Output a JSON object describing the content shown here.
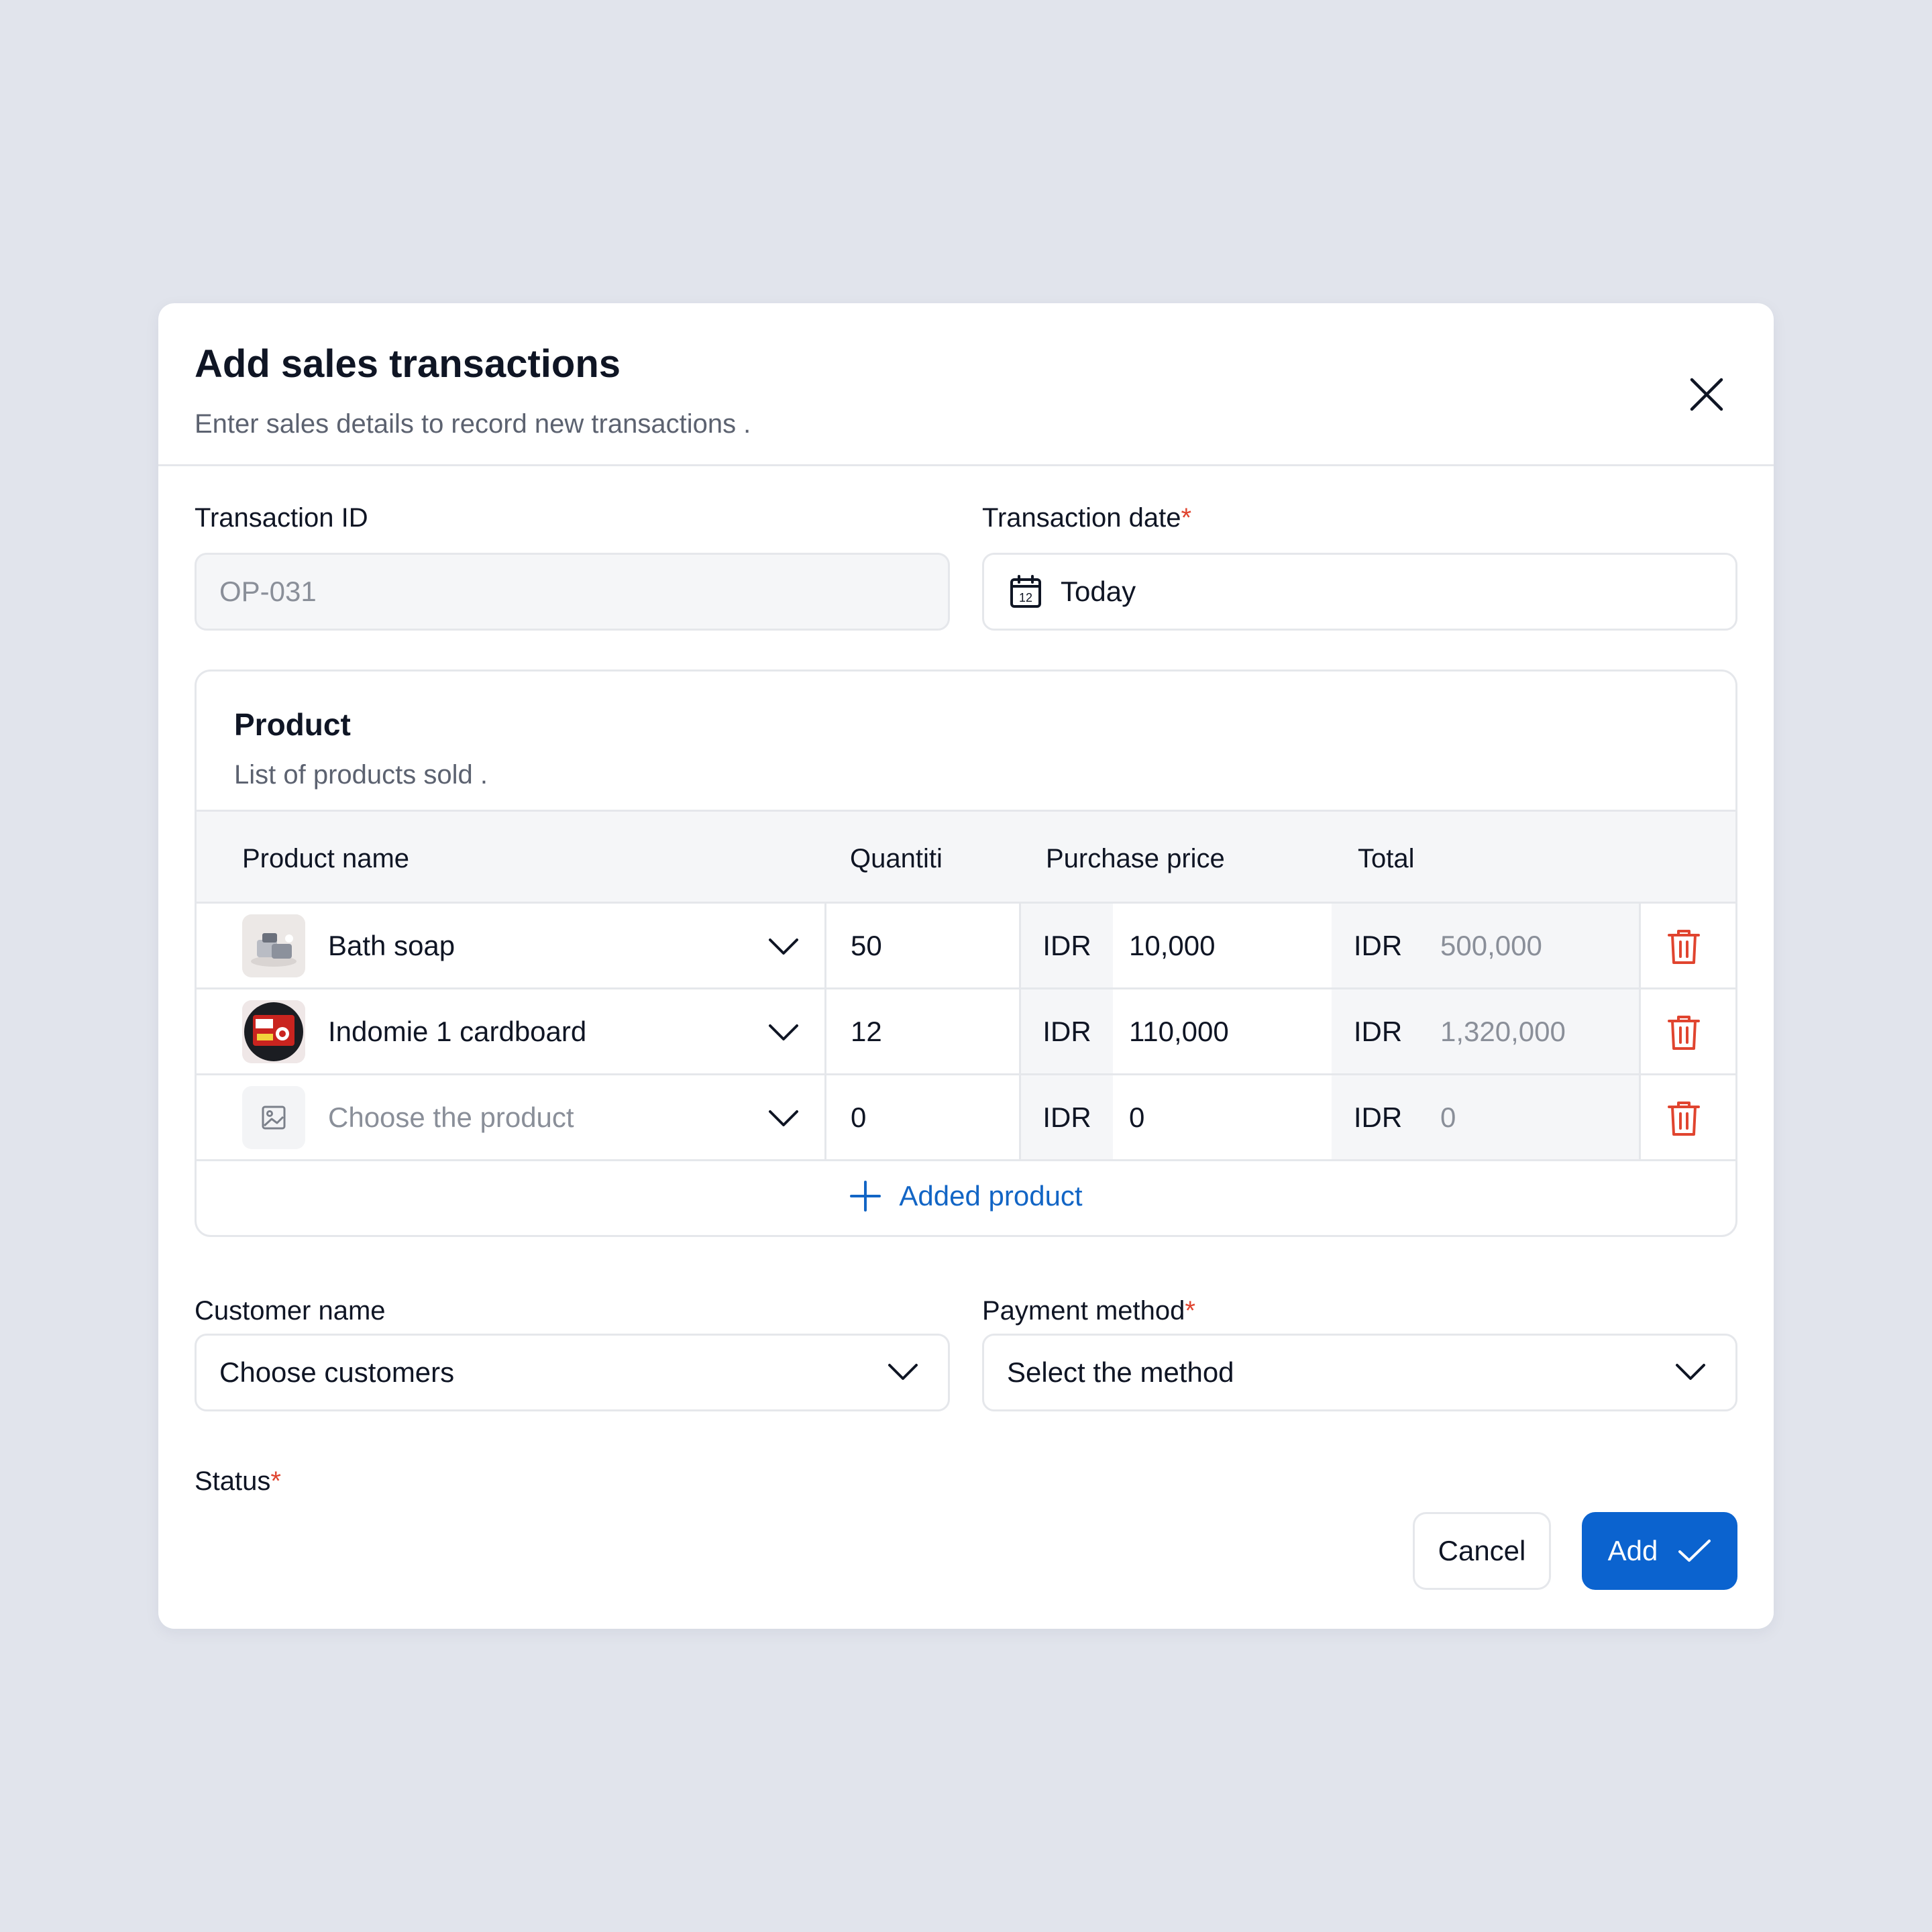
{
  "modal": {
    "title": "Add sales transactions",
    "subtitle": "Enter sales details to record new transactions ."
  },
  "transaction_id": {
    "label": "Transaction ID",
    "value": "OP-031"
  },
  "transaction_date": {
    "label": "Transaction date",
    "required_mark": "*",
    "value": "Today",
    "calendar_day": "12"
  },
  "product_section": {
    "title": "Product",
    "subtitle": "List of products sold .",
    "columns": {
      "name": "Product name",
      "qty": "Quantiti",
      "price": "Purchase price",
      "total": "Total"
    },
    "currency": "IDR",
    "rows": [
      {
        "name": "Bath soap",
        "qty": "50",
        "price": "10,000",
        "total": "500,000",
        "placeholder": false
      },
      {
        "name": "Indomie 1 cardboard",
        "qty": "12",
        "price": "110,000",
        "total": "1,320,000",
        "placeholder": false
      },
      {
        "name": "Choose the product",
        "qty": "0",
        "price": "0",
        "total": "0",
        "placeholder": true
      }
    ],
    "add_label": "Added product"
  },
  "customer": {
    "label": "Customer name",
    "value": "Choose customers"
  },
  "payment": {
    "label": "Payment method",
    "required_mark": "*",
    "value": "Select the method"
  },
  "status": {
    "label": "Status",
    "required_mark": "*"
  },
  "actions": {
    "cancel": "Cancel",
    "add": "Add"
  },
  "colors": {
    "primary": "#0b63cf",
    "link": "#1265c5",
    "danger": "#e0442f",
    "background": "#e1e4ec"
  }
}
